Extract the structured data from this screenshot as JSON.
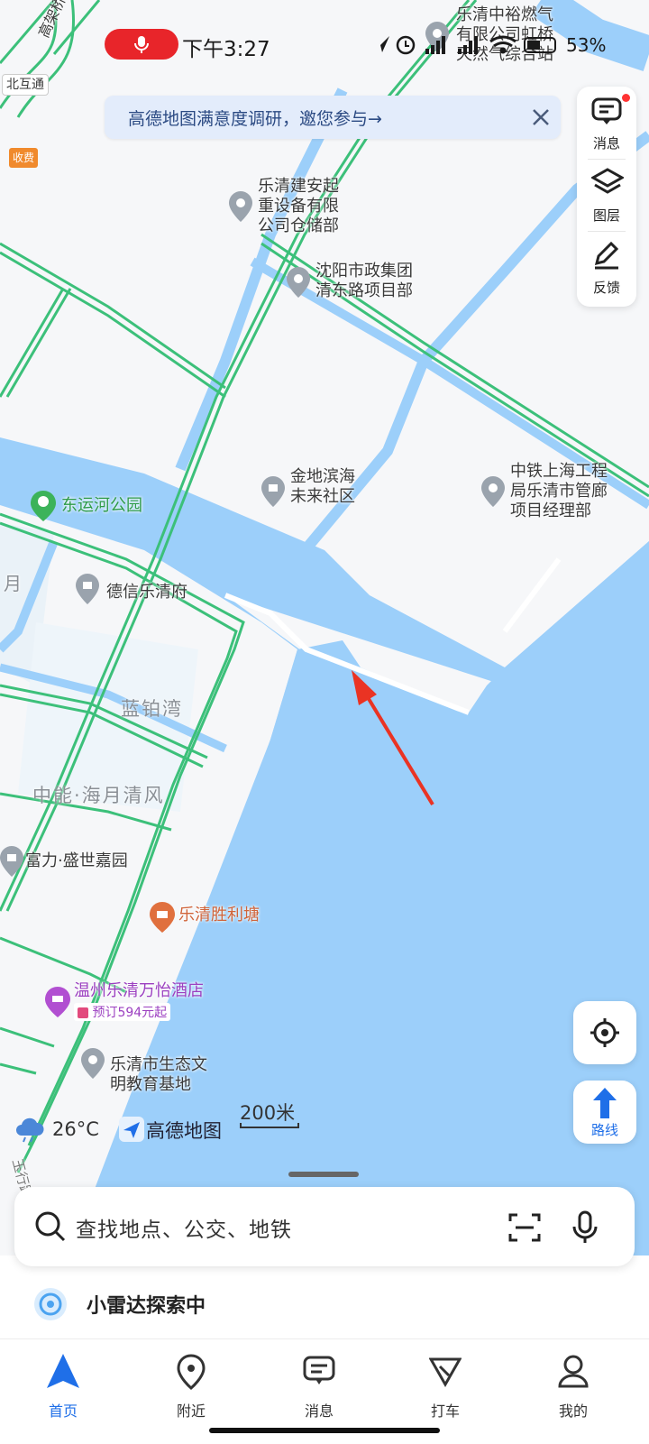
{
  "status_bar": {
    "time": "下午3:27",
    "battery": "53%"
  },
  "banner": {
    "text": "高德地图满意度调研，邀您参与→"
  },
  "toolbar": {
    "messages_label": "消息",
    "layers_label": "图层",
    "feedback_label": "反馈"
  },
  "route_button": {
    "label": "路线"
  },
  "map": {
    "labels": {
      "bridge": "高架桥",
      "interchange": "北互通",
      "toll": "收费",
      "gas_station": "乐清中裕燃气\n有限公司虹桥\n天然气综合站",
      "equipment": "乐清建安起\n重设备有限\n公司仓储部",
      "shenyang": "沈阳市政集团\n清东路项目部",
      "jindi": "金地滨海\n未来社区",
      "china_railway": "中铁上海工程\n局乐清市管廊\n项目经理部",
      "park": "东运河公园",
      "moon": "月",
      "dexin": "德信乐清府",
      "lanbowan": "蓝铂湾",
      "zhongneng": "中能·海月清风",
      "fuli": "富力·盛世嘉园",
      "shengli": "乐清胜利塘",
      "hotel": "温州乐清万怡酒店",
      "hotel_price": "预订594元起",
      "eco_base": "乐清市生态文\n明教育基地",
      "road": "玉行路"
    }
  },
  "footer_info": {
    "temperature": "26°C",
    "brand": "高德地图",
    "scale": "200米"
  },
  "search": {
    "placeholder": "查找地点、公交、地铁"
  },
  "radar": {
    "text": "小雷达探索中"
  },
  "nav": {
    "items": [
      {
        "label": "首页"
      },
      {
        "label": "附近"
      },
      {
        "label": "消息"
      },
      {
        "label": "打车"
      },
      {
        "label": "我的"
      }
    ]
  },
  "colors": {
    "water": "#9ccffa",
    "road_green": "#3cc07a",
    "accent_blue": "#1f6fe8",
    "arrow_red": "#ea3323"
  }
}
